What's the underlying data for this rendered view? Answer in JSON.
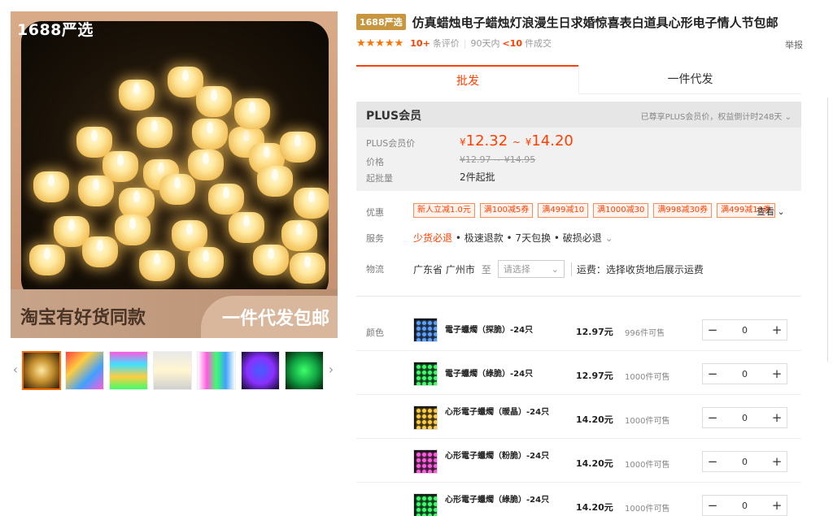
{
  "gallery": {
    "badge": "1688严选",
    "promo_left": "淘宝有好货同款",
    "promo_right": "一件代发包邮",
    "thumb_prev": "‹",
    "thumb_next": "›"
  },
  "product": {
    "badge": "1688严选",
    "title": "仿真蜡烛电子蜡烛灯浪漫生日求婚惊喜表白道具心形电子情人节包邮",
    "stars": "★★★★★",
    "reviews_count": "10+",
    "reviews_label": "条评价",
    "sold_period": "90天内",
    "sold_count": "<10",
    "sold_label": "件成交",
    "report": "举报"
  },
  "tabs": [
    "批发",
    "一件代发"
  ],
  "plus": {
    "title": "PLUS会员",
    "note": "已尊享PLUS会员价，权益倒计时248天",
    "price_label": "PLUS会员价",
    "price_currency": "¥",
    "price_low": "12.32",
    "price_sep": "~",
    "price_high": "14.20",
    "old_label": "价格",
    "old_price": "¥12.97 ~ ¥14.95",
    "moq_label": "起批量",
    "moq": "2件起批"
  },
  "offers": {
    "label": "优惠",
    "coupons": [
      "新人立减1.0元",
      "满100减5券",
      "满499减10",
      "满1000减30",
      "满998减30券",
      "满499减10券"
    ],
    "see_more": "查看"
  },
  "service": {
    "label": "服务",
    "first": "少货必退",
    "rest": " • 极速退款 • 7天包换 • 破损必退"
  },
  "logistics": {
    "label": "物流",
    "origin": "广东省 广州市",
    "to": "至",
    "select_placeholder": "请选择",
    "freight": "运费：选择收货地后展示运费"
  },
  "color_label": "颜色",
  "skus": [
    {
      "name": "電子蠟燭（探脆）-24只",
      "price": "12.97元",
      "stock": "996件可售",
      "qty": "0",
      "dot": "#5aa0ff"
    },
    {
      "name": "電子蠟燭（綠脆）-24只",
      "price": "12.97元",
      "stock": "1000件可售",
      "qty": "0",
      "dot": "#3cff6a"
    },
    {
      "name": "心形電子蠟燭（暖晶）-24只",
      "price": "14.20元",
      "stock": "1000件可售",
      "qty": "0",
      "dot": "#ffcc40"
    },
    {
      "name": "心形電子蠟燭（粉脆）-24只",
      "price": "14.20元",
      "stock": "1000件可售",
      "qty": "0",
      "dot": "#ff5ae0"
    },
    {
      "name": "心形電子蠟燭（綠脆）-24只",
      "price": "14.20元",
      "stock": "1000件可售",
      "qty": "0",
      "dot": "#3cff6a"
    }
  ],
  "stepper": {
    "minus": "−",
    "plus": "+"
  }
}
